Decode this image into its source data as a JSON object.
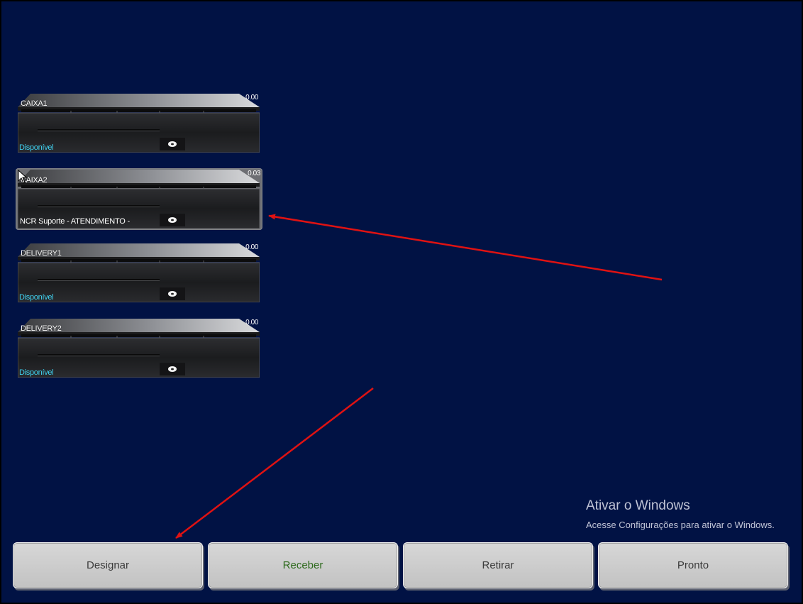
{
  "drawers": [
    {
      "name": "CAIXA1",
      "value": "0.00",
      "status": "Disponível"
    },
    {
      "name": "CAIXA2",
      "value": "0.03",
      "status": "NCR Suporte - ATENDIMENTO -"
    },
    {
      "name": "DELIVERY1",
      "value": "0.00",
      "status": "Disponível"
    },
    {
      "name": "DELIVERY2",
      "value": "0.00",
      "status": "Disponível"
    }
  ],
  "watermark": {
    "title": "Ativar o Windows",
    "subtitle": "Acesse Configurações para ativar o Windows."
  },
  "buttons": {
    "designar": "Designar",
    "receber": "Receber",
    "retirar": "Retirar",
    "pronto": "Pronto"
  },
  "colors": {
    "background": "#011244",
    "available_status": "#3fd0ee",
    "annotation_arrow": "#e01212"
  }
}
